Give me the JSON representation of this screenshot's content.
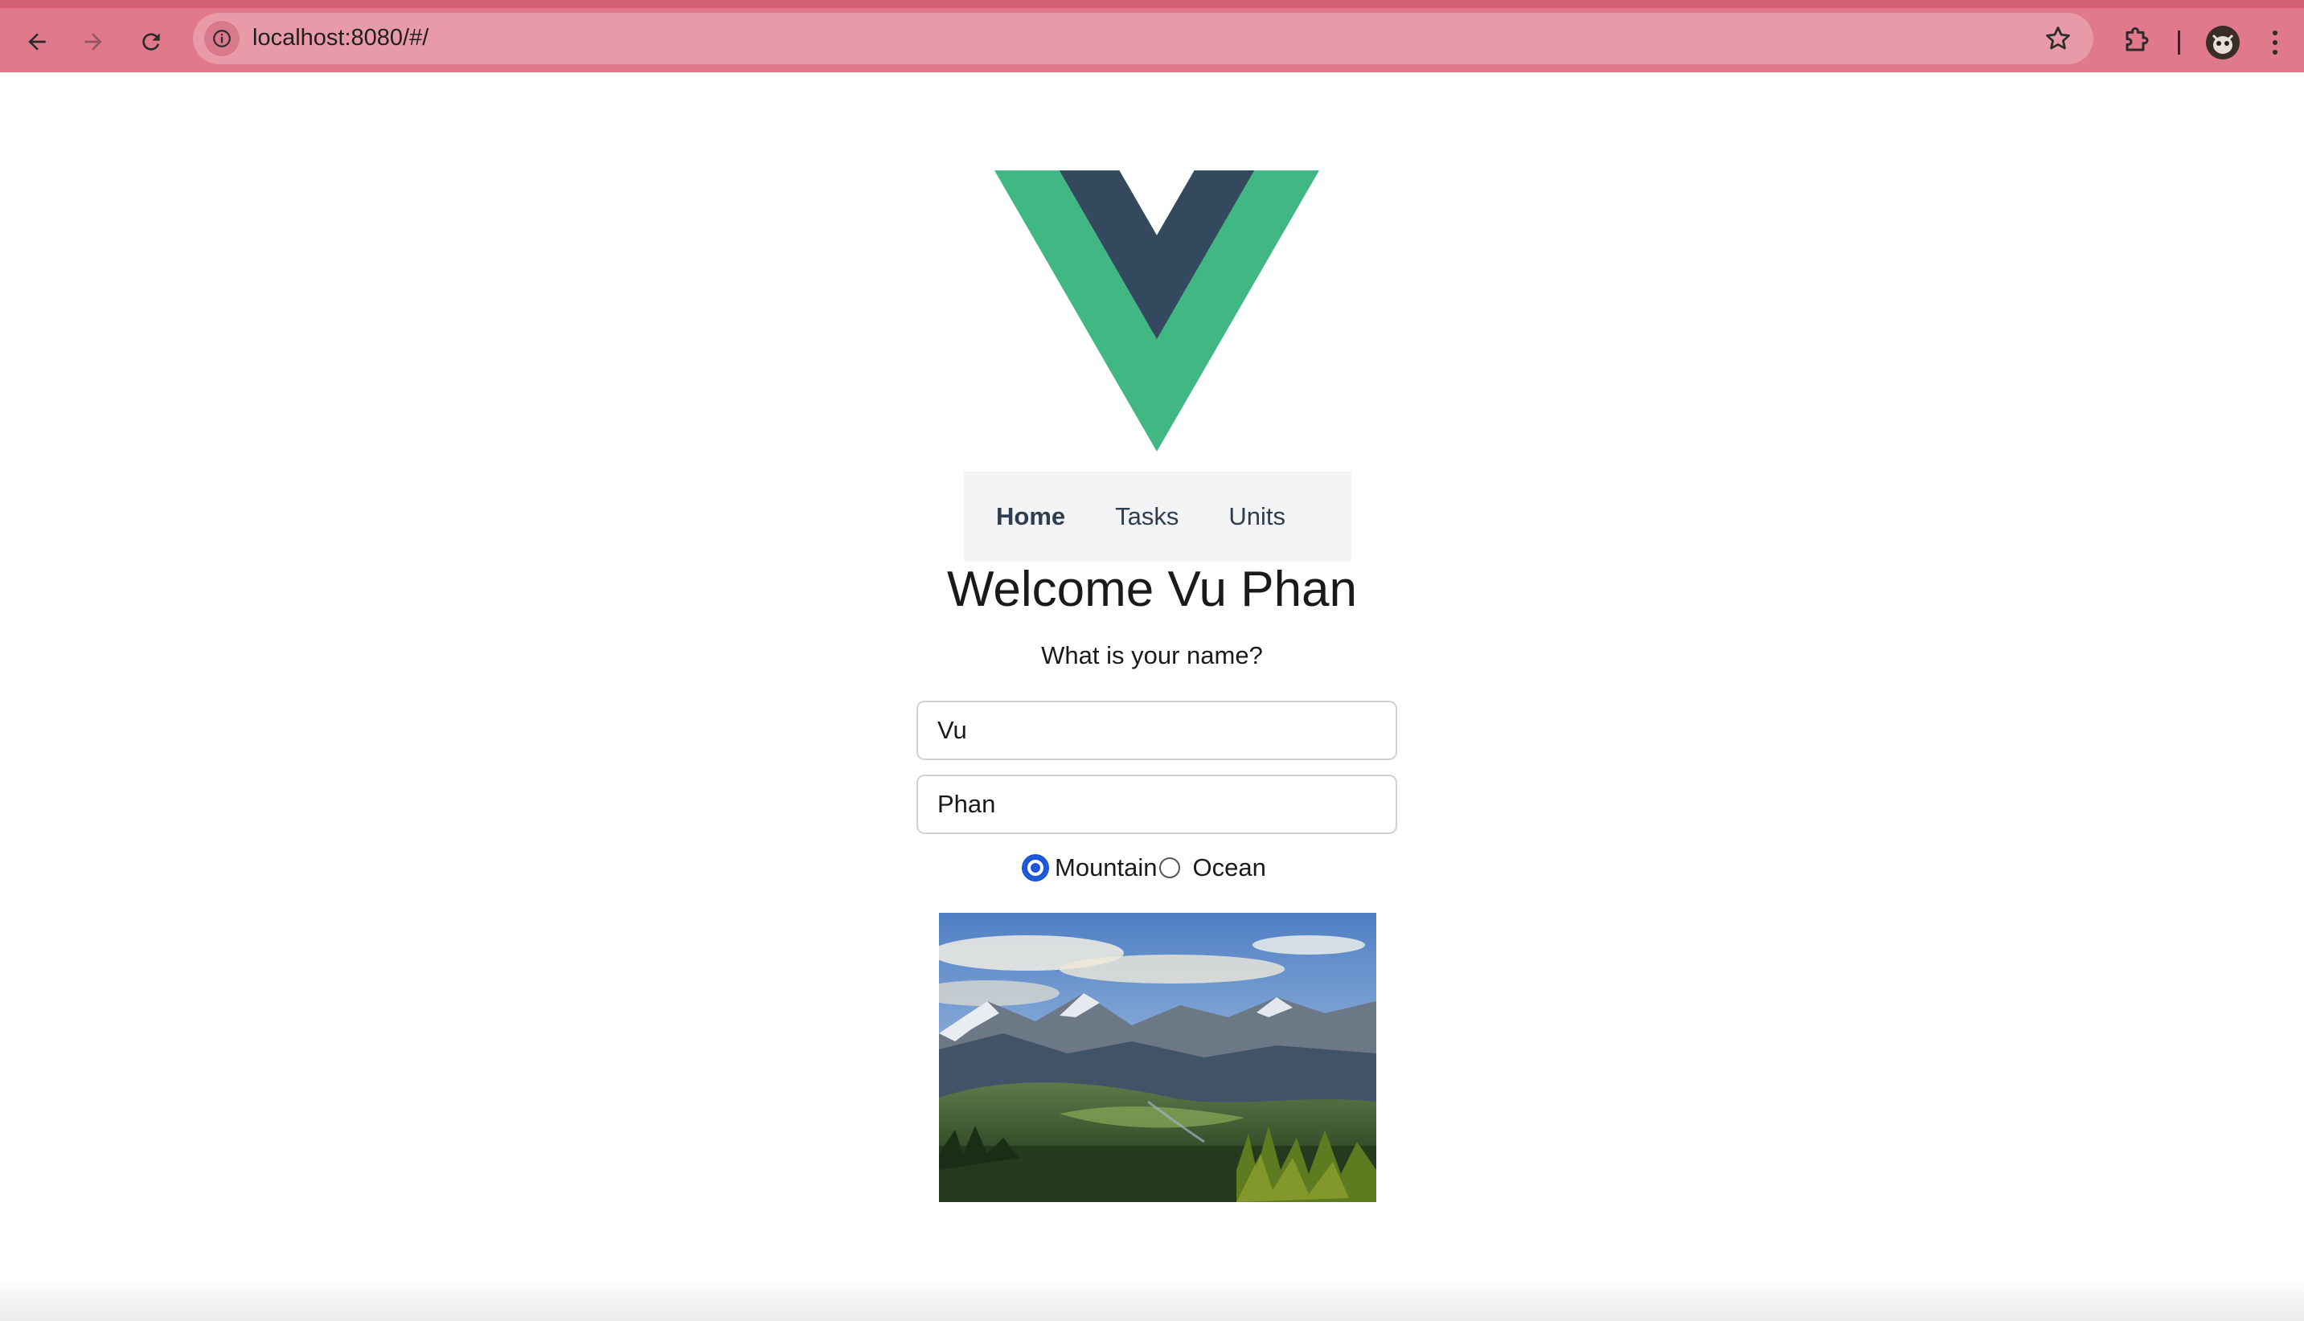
{
  "browser": {
    "url": "localhost:8080/#/",
    "toolbar_color": "#e0798c"
  },
  "app": {
    "nav": {
      "items": [
        {
          "label": "Home",
          "active": true
        },
        {
          "label": "Tasks",
          "active": false
        },
        {
          "label": "Units",
          "active": false
        }
      ]
    },
    "welcome_text": "Welcome Vu Phan",
    "question": "What is your name?",
    "first_name": {
      "value": "Vu"
    },
    "last_name": {
      "value": "Phan"
    },
    "scenery": {
      "options": [
        {
          "label": "Mountain",
          "checked": true
        },
        {
          "label": "Ocean",
          "checked": false
        }
      ]
    },
    "colors": {
      "vue_green": "#41b883",
      "vue_dark": "#34495e",
      "radio_accent": "#1a56d6"
    }
  }
}
